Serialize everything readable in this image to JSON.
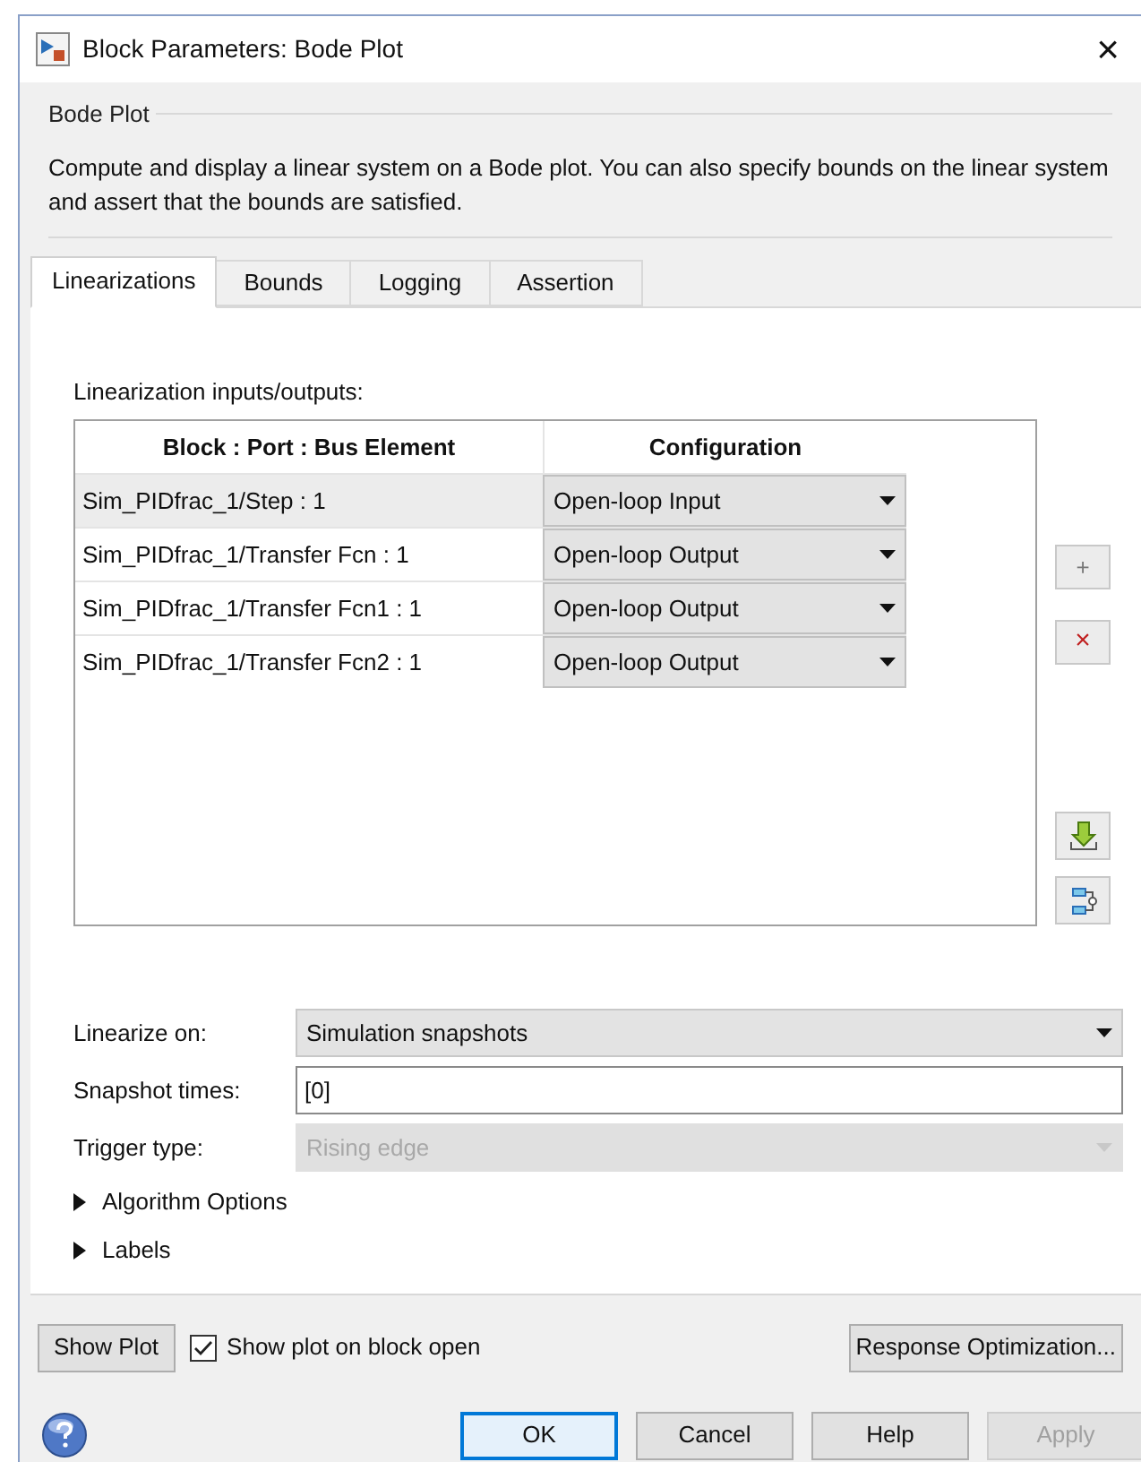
{
  "window": {
    "title": "Block Parameters: Bode Plot",
    "close": "×"
  },
  "group": {
    "title": "Bode Plot",
    "description": "Compute and display a linear system on a Bode plot. You can also specify bounds on the linear system and assert that the bounds are satisfied."
  },
  "tabs": [
    {
      "label": "Linearizations",
      "selected": true
    },
    {
      "label": "Bounds",
      "selected": false
    },
    {
      "label": "Logging",
      "selected": false
    },
    {
      "label": "Assertion",
      "selected": false
    }
  ],
  "io_label": "Linearization inputs/outputs:",
  "table": {
    "columns": [
      "Block : Port : Bus Element",
      "Configuration"
    ],
    "rows": [
      {
        "block": "Sim_PIDfrac_1/Step : 1",
        "configuration": "Open-loop Input",
        "selected": true
      },
      {
        "block": "Sim_PIDfrac_1/Transfer Fcn : 1",
        "configuration": "Open-loop Output",
        "selected": false
      },
      {
        "block": "Sim_PIDfrac_1/Transfer Fcn1 : 1",
        "configuration": "Open-loop Output",
        "selected": false
      },
      {
        "block": "Sim_PIDfrac_1/Transfer Fcn2 : 1",
        "configuration": "Open-loop Output",
        "selected": false
      }
    ]
  },
  "side_buttons": {
    "add": "+",
    "remove": "×"
  },
  "fields": [
    {
      "kind": "dropdown",
      "label": "Linearize on:",
      "value": "Simulation snapshots",
      "disabled": false
    },
    {
      "kind": "text",
      "label": "Snapshot times:",
      "value": "[0]",
      "disabled": false
    },
    {
      "kind": "dropdown",
      "label": "Trigger type:",
      "value": "Rising edge",
      "disabled": true
    }
  ],
  "sections": [
    {
      "label": "Algorithm Options",
      "expanded": false
    },
    {
      "label": "Labels",
      "expanded": false
    }
  ],
  "show_plot_button": "Show Plot",
  "show_plot_checkbox": {
    "label": "Show plot on block open",
    "checked": true
  },
  "response_button": "Response Optimization...",
  "buttons": [
    {
      "label": "OK",
      "kind": "default",
      "disabled": false
    },
    {
      "label": "Cancel",
      "kind": "normal",
      "disabled": false
    },
    {
      "label": "Help",
      "kind": "normal",
      "disabled": false
    },
    {
      "label": "Apply",
      "kind": "normal",
      "disabled": true
    }
  ]
}
